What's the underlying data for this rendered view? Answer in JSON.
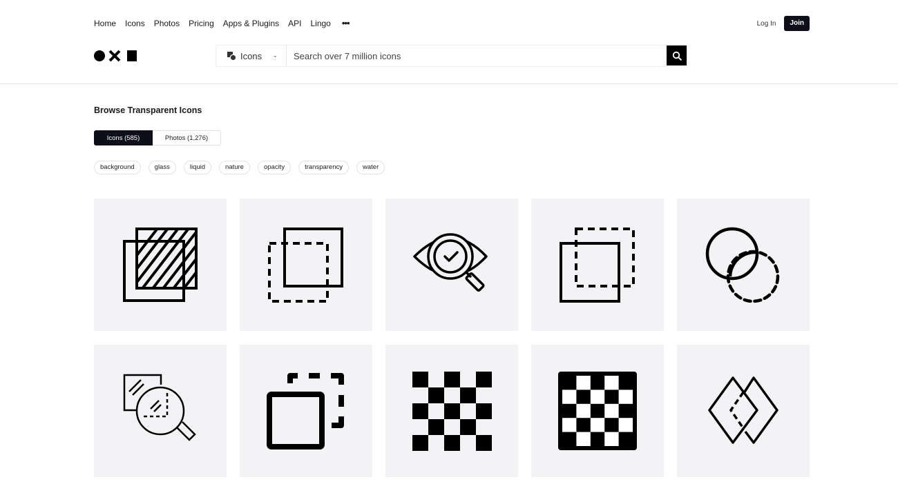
{
  "nav": {
    "items": [
      "Home",
      "Icons",
      "Photos",
      "Pricing",
      "Apps & Plugins",
      "API",
      "Lingo"
    ],
    "more_label": "•••"
  },
  "auth": {
    "login_label": "Log In",
    "join_label": "Join"
  },
  "search": {
    "type_label": "Icons",
    "placeholder": "Search over 7 million icons",
    "value": ""
  },
  "page": {
    "heading": "Browse Transparent Icons",
    "tabs": [
      {
        "label": "Icons (585)",
        "active": true
      },
      {
        "label": "Photos (1,276)",
        "active": false
      }
    ],
    "tags": [
      "background",
      "glass",
      "liquid",
      "nature",
      "opacity",
      "transparency",
      "water"
    ]
  },
  "icons": [
    {
      "name": "hatched-overlapping-squares-icon"
    },
    {
      "name": "square-over-dashed-square-icon"
    },
    {
      "name": "eye-magnifier-check-icon"
    },
    {
      "name": "square-under-dashed-square-icon"
    },
    {
      "name": "circle-dashed-circle-icon"
    },
    {
      "name": "glass-magnifier-icon"
    },
    {
      "name": "square-dashed-corner-square-icon"
    },
    {
      "name": "checkerboard-icon"
    },
    {
      "name": "checkerboard-framed-icon"
    },
    {
      "name": "diamonds-dashed-overlap-icon"
    }
  ],
  "colors": {
    "accent": "#0e0e1a",
    "tile_bg": "#f3f3f5"
  }
}
